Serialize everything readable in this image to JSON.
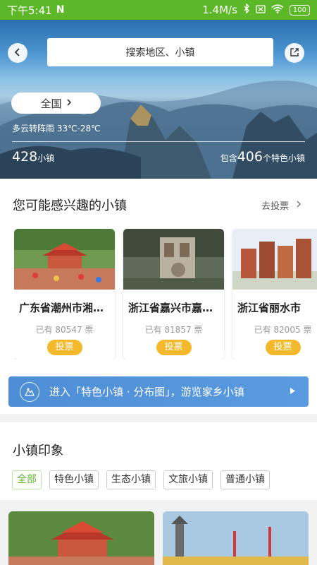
{
  "status_bar": {
    "time": "下午5:41",
    "network_speed": "1.4M/s",
    "battery": "100"
  },
  "header": {
    "search_placeholder": "搜索地区、小镇"
  },
  "hero": {
    "region": "全国",
    "weather": "多云转阵雨 33℃-28℃",
    "town_count": "428",
    "town_unit": "小镇",
    "feature_prefix": "包含",
    "feature_count": "406",
    "feature_suffix": "个特色小镇"
  },
  "interest": {
    "title": "您可能感兴趣的小镇",
    "vote_link": "去投票",
    "cards": [
      {
        "name": "广东省潮州市湘桥区",
        "votes": "已有 80547 票",
        "button": "投票"
      },
      {
        "name": "浙江省嘉兴市嘉善县",
        "votes": "已有 81857 票",
        "button": "投票"
      },
      {
        "name": "浙江省丽水市",
        "votes": "已有 82005 票",
        "button": "投票"
      }
    ]
  },
  "map_banner": {
    "text": "进入「特色小镇 · 分布图」，游览家乡小镇"
  },
  "impression": {
    "title": "小镇印象",
    "tags": [
      "全部",
      "特色小镇",
      "生态小镇",
      "文旅小镇",
      "普通小镇"
    ],
    "active_tag": "全部"
  },
  "colors": {
    "status_bar": "#5cb829",
    "vote_button": "#f4b82b",
    "banner": "#4d8ed6",
    "active_tag": "#5cb829"
  },
  "icons": [
    "back-icon",
    "share-icon",
    "chevron-right-icon",
    "map-icon",
    "play-icon"
  ]
}
